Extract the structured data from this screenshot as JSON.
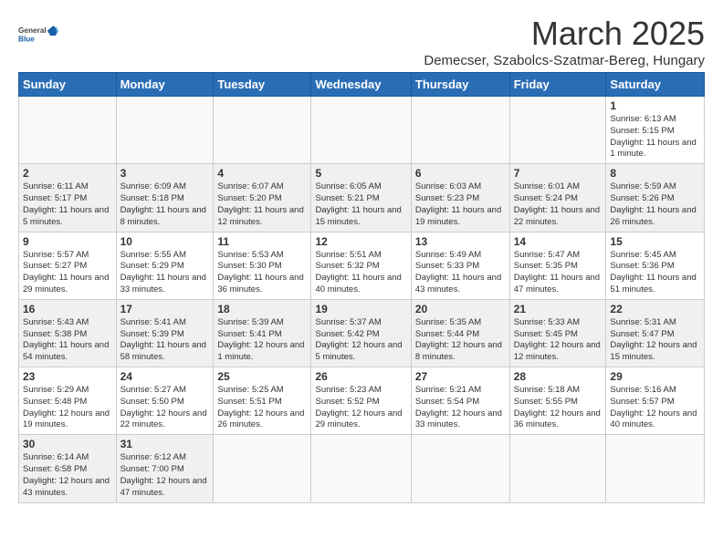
{
  "header": {
    "logo_general": "General",
    "logo_blue": "Blue",
    "month_title": "March 2025",
    "location": "Demecser, Szabolcs-Szatmar-Bereg, Hungary"
  },
  "weekdays": [
    "Sunday",
    "Monday",
    "Tuesday",
    "Wednesday",
    "Thursday",
    "Friday",
    "Saturday"
  ],
  "weeks": [
    [
      {
        "day": "",
        "info": ""
      },
      {
        "day": "",
        "info": ""
      },
      {
        "day": "",
        "info": ""
      },
      {
        "day": "",
        "info": ""
      },
      {
        "day": "",
        "info": ""
      },
      {
        "day": "",
        "info": ""
      },
      {
        "day": "1",
        "info": "Sunrise: 6:13 AM\nSunset: 5:15 PM\nDaylight: 11 hours and 1 minute."
      }
    ],
    [
      {
        "day": "2",
        "info": "Sunrise: 6:11 AM\nSunset: 5:17 PM\nDaylight: 11 hours and 5 minutes."
      },
      {
        "day": "3",
        "info": "Sunrise: 6:09 AM\nSunset: 5:18 PM\nDaylight: 11 hours and 8 minutes."
      },
      {
        "day": "4",
        "info": "Sunrise: 6:07 AM\nSunset: 5:20 PM\nDaylight: 11 hours and 12 minutes."
      },
      {
        "day": "5",
        "info": "Sunrise: 6:05 AM\nSunset: 5:21 PM\nDaylight: 11 hours and 15 minutes."
      },
      {
        "day": "6",
        "info": "Sunrise: 6:03 AM\nSunset: 5:23 PM\nDaylight: 11 hours and 19 minutes."
      },
      {
        "day": "7",
        "info": "Sunrise: 6:01 AM\nSunset: 5:24 PM\nDaylight: 11 hours and 22 minutes."
      },
      {
        "day": "8",
        "info": "Sunrise: 5:59 AM\nSunset: 5:26 PM\nDaylight: 11 hours and 26 minutes."
      }
    ],
    [
      {
        "day": "9",
        "info": "Sunrise: 5:57 AM\nSunset: 5:27 PM\nDaylight: 11 hours and 29 minutes."
      },
      {
        "day": "10",
        "info": "Sunrise: 5:55 AM\nSunset: 5:29 PM\nDaylight: 11 hours and 33 minutes."
      },
      {
        "day": "11",
        "info": "Sunrise: 5:53 AM\nSunset: 5:30 PM\nDaylight: 11 hours and 36 minutes."
      },
      {
        "day": "12",
        "info": "Sunrise: 5:51 AM\nSunset: 5:32 PM\nDaylight: 11 hours and 40 minutes."
      },
      {
        "day": "13",
        "info": "Sunrise: 5:49 AM\nSunset: 5:33 PM\nDaylight: 11 hours and 43 minutes."
      },
      {
        "day": "14",
        "info": "Sunrise: 5:47 AM\nSunset: 5:35 PM\nDaylight: 11 hours and 47 minutes."
      },
      {
        "day": "15",
        "info": "Sunrise: 5:45 AM\nSunset: 5:36 PM\nDaylight: 11 hours and 51 minutes."
      }
    ],
    [
      {
        "day": "16",
        "info": "Sunrise: 5:43 AM\nSunset: 5:38 PM\nDaylight: 11 hours and 54 minutes."
      },
      {
        "day": "17",
        "info": "Sunrise: 5:41 AM\nSunset: 5:39 PM\nDaylight: 11 hours and 58 minutes."
      },
      {
        "day": "18",
        "info": "Sunrise: 5:39 AM\nSunset: 5:41 PM\nDaylight: 12 hours and 1 minute."
      },
      {
        "day": "19",
        "info": "Sunrise: 5:37 AM\nSunset: 5:42 PM\nDaylight: 12 hours and 5 minutes."
      },
      {
        "day": "20",
        "info": "Sunrise: 5:35 AM\nSunset: 5:44 PM\nDaylight: 12 hours and 8 minutes."
      },
      {
        "day": "21",
        "info": "Sunrise: 5:33 AM\nSunset: 5:45 PM\nDaylight: 12 hours and 12 minutes."
      },
      {
        "day": "22",
        "info": "Sunrise: 5:31 AM\nSunset: 5:47 PM\nDaylight: 12 hours and 15 minutes."
      }
    ],
    [
      {
        "day": "23",
        "info": "Sunrise: 5:29 AM\nSunset: 5:48 PM\nDaylight: 12 hours and 19 minutes."
      },
      {
        "day": "24",
        "info": "Sunrise: 5:27 AM\nSunset: 5:50 PM\nDaylight: 12 hours and 22 minutes."
      },
      {
        "day": "25",
        "info": "Sunrise: 5:25 AM\nSunset: 5:51 PM\nDaylight: 12 hours and 26 minutes."
      },
      {
        "day": "26",
        "info": "Sunrise: 5:23 AM\nSunset: 5:52 PM\nDaylight: 12 hours and 29 minutes."
      },
      {
        "day": "27",
        "info": "Sunrise: 5:21 AM\nSunset: 5:54 PM\nDaylight: 12 hours and 33 minutes."
      },
      {
        "day": "28",
        "info": "Sunrise: 5:18 AM\nSunset: 5:55 PM\nDaylight: 12 hours and 36 minutes."
      },
      {
        "day": "29",
        "info": "Sunrise: 5:16 AM\nSunset: 5:57 PM\nDaylight: 12 hours and 40 minutes."
      }
    ],
    [
      {
        "day": "30",
        "info": "Sunrise: 6:14 AM\nSunset: 6:58 PM\nDaylight: 12 hours and 43 minutes."
      },
      {
        "day": "31",
        "info": "Sunrise: 6:12 AM\nSunset: 7:00 PM\nDaylight: 12 hours and 47 minutes."
      },
      {
        "day": "",
        "info": ""
      },
      {
        "day": "",
        "info": ""
      },
      {
        "day": "",
        "info": ""
      },
      {
        "day": "",
        "info": ""
      },
      {
        "day": "",
        "info": ""
      }
    ]
  ]
}
